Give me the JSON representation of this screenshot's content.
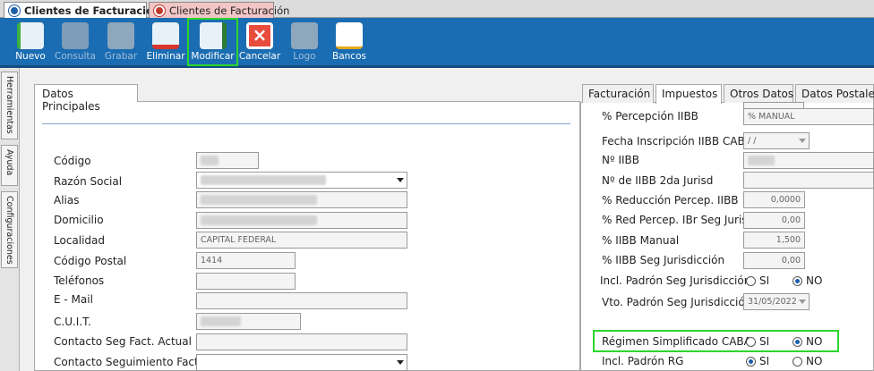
{
  "doc_tabs": [
    {
      "label": "Clientes de Facturación",
      "active": true
    },
    {
      "label": "Clientes de Facturación",
      "active": false
    }
  ],
  "toolbar": {
    "buttons": [
      {
        "label": "Nuevo",
        "icon": "new-document-icon",
        "enabled": true
      },
      {
        "label": "Consulta",
        "icon": "query-icon",
        "enabled": false
      },
      {
        "label": "Grabar",
        "icon": "save-disk-icon",
        "enabled": false
      },
      {
        "label": "Eliminar",
        "icon": "delete-document-icon",
        "enabled": true
      },
      {
        "label": "Modificar",
        "icon": "edit-pencil-icon",
        "enabled": true,
        "highlighted": true
      },
      {
        "label": "Cancelar",
        "icon": "cancel-icon",
        "enabled": true
      },
      {
        "label": "Logo",
        "icon": "logo-icon",
        "enabled": false
      },
      {
        "label": "Bancos",
        "icon": "bank-chart-icon",
        "enabled": true
      }
    ]
  },
  "side_tabs": [
    "Herramientas",
    "Ayuda",
    "Configuraciones"
  ],
  "left_panel": {
    "tab_label": "Datos Principales",
    "fields": [
      {
        "label": "Código",
        "value": ""
      },
      {
        "label": "Razón Social",
        "value": ""
      },
      {
        "label": "Alias",
        "value": ""
      },
      {
        "label": "Domicilio",
        "value": ""
      },
      {
        "label": "Localidad",
        "value": "CAPITAL FEDERAL"
      },
      {
        "label": "Código Postal",
        "value": "1414"
      },
      {
        "label": "Teléfonos",
        "value": ""
      },
      {
        "label": "E - Mail",
        "value": ""
      },
      {
        "label": "C.U.I.T.",
        "value": ""
      },
      {
        "label": "Contacto Seg Fact. Actual",
        "value": ""
      },
      {
        "label": "Contacto Seguimiento Fact.",
        "value": ""
      }
    ]
  },
  "right_panel": {
    "tabs": [
      "Facturación",
      "Impuestos",
      "Otros Datos",
      "Datos Postales"
    ],
    "active_tab": "Impuestos",
    "fields": {
      "percepcion_iibb": {
        "label": "% Percepción IIBB",
        "value": "% MANUAL"
      },
      "fecha_inscripcion": {
        "label": "Fecha Inscripción IIBB CABA",
        "value": " /  /"
      },
      "nro_iibb": {
        "label": "Nº IIBB",
        "value": ""
      },
      "nro_iibb_2da": {
        "label": "Nº de IIBB 2da Jurisd",
        "value": ""
      },
      "reduccion_percep": {
        "label": "% Reducción Percep. IIBB",
        "value": "0,0000"
      },
      "red_percep_seg": {
        "label": "% Red Percep. IBr Seg Jurisd",
        "value": "0,00"
      },
      "iibb_manual": {
        "label": "% IIBB Manual",
        "value": "1,500"
      },
      "iibb_seg_jur": {
        "label": "% IIBB Seg Jurisdicción",
        "value": "0,00"
      },
      "incl_padron_seg": {
        "label": "Incl. Padrón Seg Jurisdicción",
        "si": "SI",
        "no": "NO",
        "selected": "NO"
      },
      "vto_padron_seg": {
        "label": "Vto. Padrón Seg Jurisdicción",
        "value": "31/05/2022"
      },
      "regimen_simplificado": {
        "label": "Régimen Simplificado CABA",
        "si": "SI",
        "no": "NO",
        "selected": "NO"
      },
      "incl_padron_rg": {
        "label": "Incl. Padrón RG",
        "si": "SI",
        "no": "NO",
        "selected": "SI"
      }
    }
  },
  "colors": {
    "toolbar": "#1b6db3",
    "highlight": "#2bd62b"
  }
}
